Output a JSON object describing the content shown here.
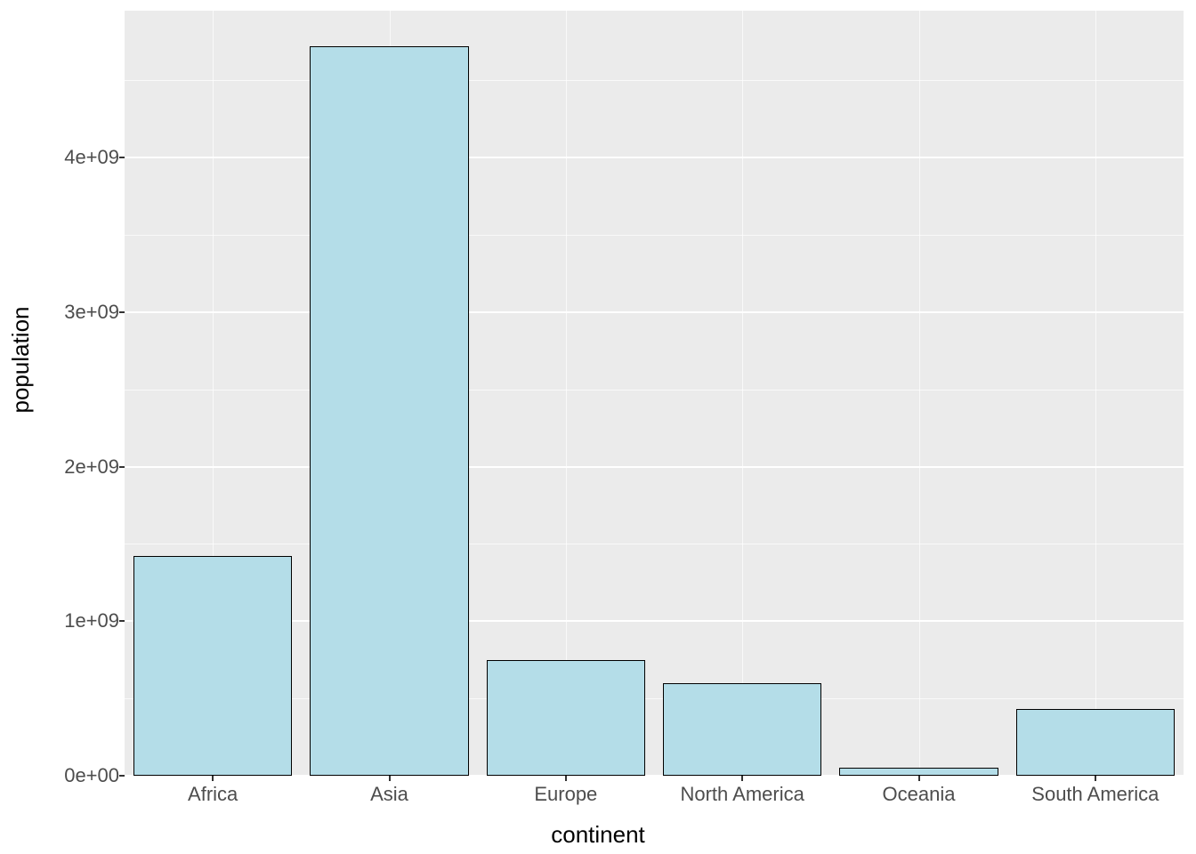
{
  "chart_data": {
    "type": "bar",
    "categories": [
      "Africa",
      "Asia",
      "Europe",
      "North America",
      "Oceania",
      "South America"
    ],
    "values": [
      1420000000.0,
      4720000000.0,
      750000000.0,
      600000000.0,
      50000000.0,
      430000000.0
    ],
    "xlabel": "continent",
    "ylabel": "population",
    "title": "",
    "ylim": [
      0,
      4950000000.0
    ],
    "y_ticks": [
      0,
      1000000000.0,
      2000000000.0,
      3000000000.0,
      4000000000.0
    ],
    "y_tick_labels": [
      "0e+00",
      "1e+09",
      "2e+09",
      "3e+09",
      "4e+09"
    ],
    "bar_fill": "#b4dde8",
    "panel_bg": "#ebebeb"
  }
}
